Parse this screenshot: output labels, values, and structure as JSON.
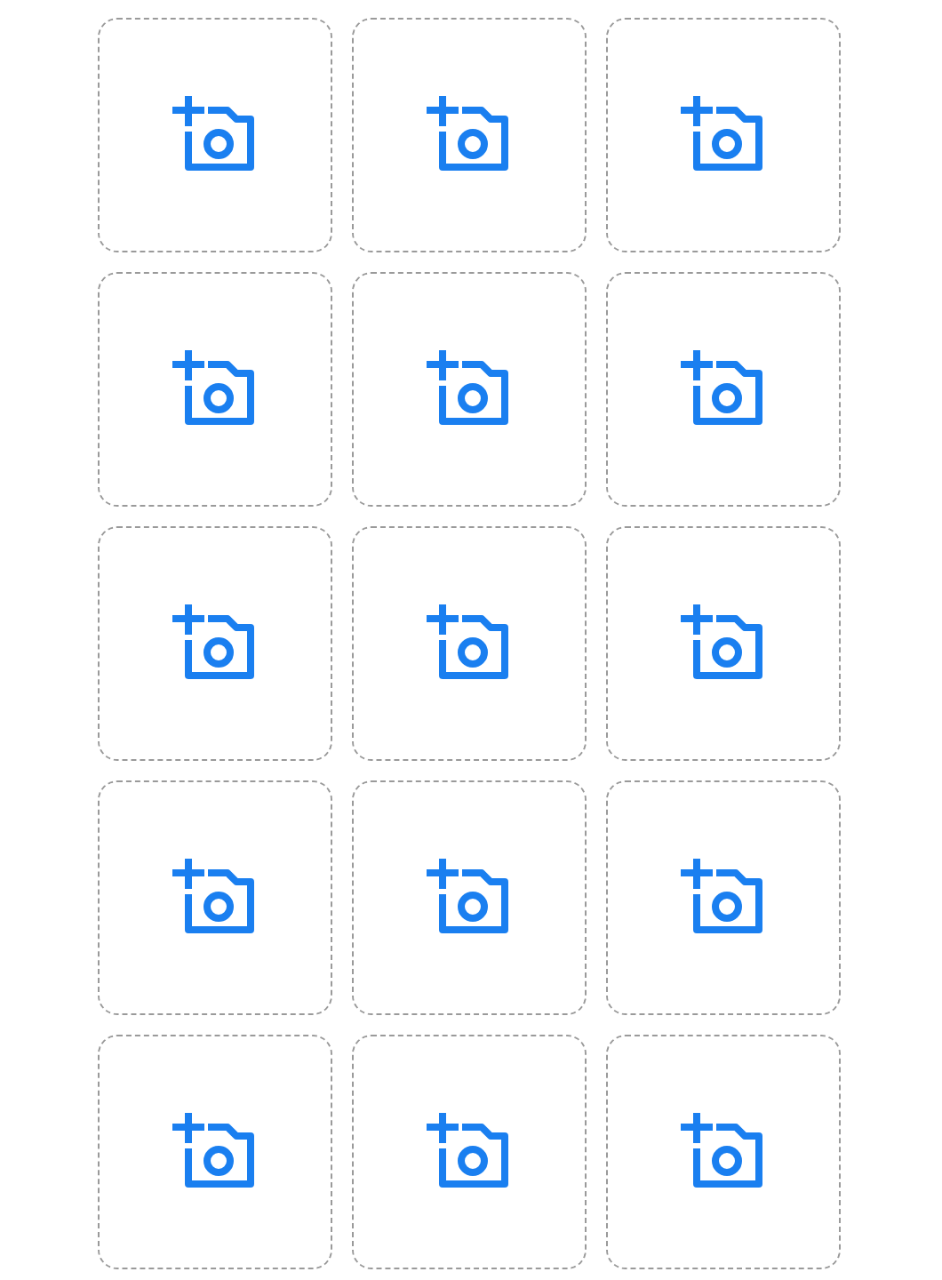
{
  "photo_slots": [
    {
      "kind": "add-photo"
    },
    {
      "kind": "add-photo"
    },
    {
      "kind": "add-photo"
    },
    {
      "kind": "add-photo"
    },
    {
      "kind": "add-photo"
    },
    {
      "kind": "add-photo"
    },
    {
      "kind": "add-photo"
    },
    {
      "kind": "add-photo"
    },
    {
      "kind": "add-photo"
    },
    {
      "kind": "add-photo"
    },
    {
      "kind": "add-photo"
    },
    {
      "kind": "add-photo"
    },
    {
      "kind": "add-photo"
    },
    {
      "kind": "add-photo"
    },
    {
      "kind": "add-photo"
    }
  ]
}
